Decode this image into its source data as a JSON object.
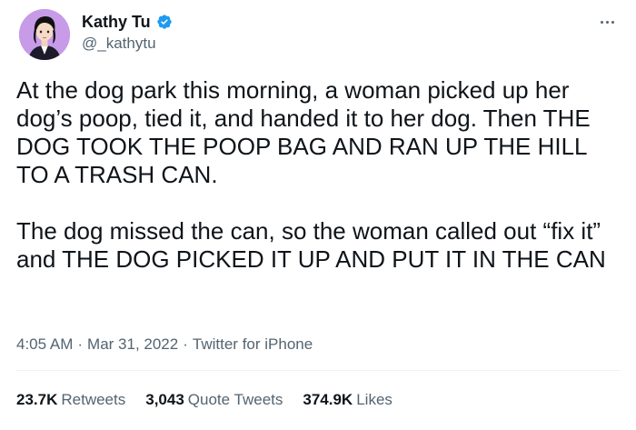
{
  "tweet": {
    "author": {
      "display_name": "Kathy Tu",
      "handle": "@_kathytu",
      "verified": true,
      "verified_color": "#1d9bf0",
      "avatar_bg": "#c79be8"
    },
    "text_paragraphs": [
      "At the dog park this morning, a woman picked up her dog’s poop, tied it, and handed it to her dog. Then THE DOG TOOK THE POOP BAG AND RAN UP THE HILL TO A TRASH CAN.",
      "The dog missed the can, so the woman called out “fix it” and THE DOG PICKED IT UP AND PUT IT IN THE CAN"
    ],
    "time": "4:05 AM",
    "date": "Mar 31, 2022",
    "source": "Twitter for iPhone",
    "separator": "·",
    "stats": {
      "retweets_count": "23.7K",
      "retweets_label": "Retweets",
      "quotes_count": "3,043",
      "quotes_label": "Quote Tweets",
      "likes_count": "374.9K",
      "likes_label": "Likes"
    }
  }
}
